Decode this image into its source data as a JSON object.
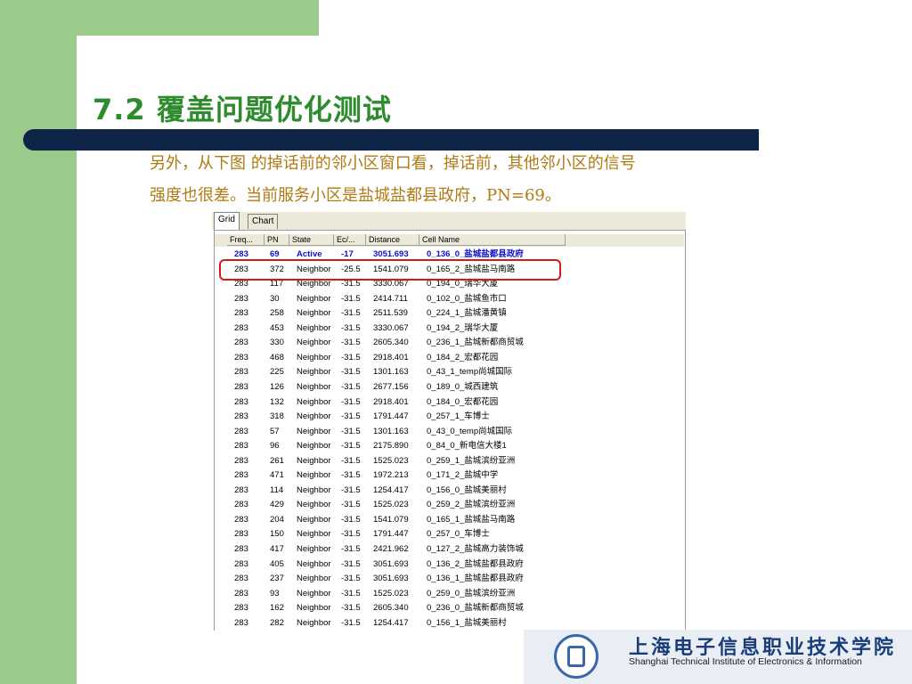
{
  "slide": {
    "title": "7.2  覆盖问题优化测试",
    "body_line1": "另外，从下图 的掉话前的邻小区窗口看，掉话前，其他邻小区的信号",
    "body_line2": "强度也很差。当前服务小区是盐城盐都县政府，PN=69。"
  },
  "app": {
    "tabs": [
      "Grid",
      "Chart"
    ],
    "selected_tab": "Grid",
    "columns": [
      "Freq...",
      "PN",
      "State",
      "Ec/...",
      "Distance",
      "Cell Name"
    ],
    "rows": [
      [
        "283",
        "69",
        "Active",
        "-17",
        "3051.693",
        "0_136_0_盐城盐都县政府"
      ],
      [
        "283",
        "372",
        "Neighbor",
        "-25.5",
        "1541.079",
        "0_165_2_盐城盐马南路"
      ],
      [
        "283",
        "117",
        "Neighbor",
        "-31.5",
        "3330.067",
        "0_194_0_瑞华大厦"
      ],
      [
        "283",
        "30",
        "Neighbor",
        "-31.5",
        "2414.711",
        "0_102_0_盐城鱼市口"
      ],
      [
        "283",
        "258",
        "Neighbor",
        "-31.5",
        "2511.539",
        "0_224_1_盐城潘黄镇"
      ],
      [
        "283",
        "453",
        "Neighbor",
        "-31.5",
        "3330.067",
        "0_194_2_瑞华大厦"
      ],
      [
        "283",
        "330",
        "Neighbor",
        "-31.5",
        "2605.340",
        "0_236_1_盐城新都商贸城"
      ],
      [
        "283",
        "468",
        "Neighbor",
        "-31.5",
        "2918.401",
        "0_184_2_宏都花园"
      ],
      [
        "283",
        "225",
        "Neighbor",
        "-31.5",
        "1301.163",
        "0_43_1_temp尚城国际"
      ],
      [
        "283",
        "126",
        "Neighbor",
        "-31.5",
        "2677.156",
        "0_189_0_城西建筑"
      ],
      [
        "283",
        "132",
        "Neighbor",
        "-31.5",
        "2918.401",
        "0_184_0_宏都花园"
      ],
      [
        "283",
        "318",
        "Neighbor",
        "-31.5",
        "1791.447",
        "0_257_1_车博士"
      ],
      [
        "283",
        "57",
        "Neighbor",
        "-31.5",
        "1301.163",
        "0_43_0_temp尚城国际"
      ],
      [
        "283",
        "96",
        "Neighbor",
        "-31.5",
        "2175.890",
        "0_84_0_新电信大楼1"
      ],
      [
        "283",
        "261",
        "Neighbor",
        "-31.5",
        "1525.023",
        "0_259_1_盐城滨纷亚洲"
      ],
      [
        "283",
        "471",
        "Neighbor",
        "-31.5",
        "1972.213",
        "0_171_2_盐城中学"
      ],
      [
        "283",
        "114",
        "Neighbor",
        "-31.5",
        "1254.417",
        "0_156_0_盐城美丽村"
      ],
      [
        "283",
        "429",
        "Neighbor",
        "-31.5",
        "1525.023",
        "0_259_2_盐城滨纷亚洲"
      ],
      [
        "283",
        "204",
        "Neighbor",
        "-31.5",
        "1541.079",
        "0_165_1_盐城盐马南路"
      ],
      [
        "283",
        "150",
        "Neighbor",
        "-31.5",
        "1791.447",
        "0_257_0_车博士"
      ],
      [
        "283",
        "417",
        "Neighbor",
        "-31.5",
        "2421.962",
        "0_127_2_盐城高力装饰城"
      ],
      [
        "283",
        "405",
        "Neighbor",
        "-31.5",
        "3051.693",
        "0_136_2_盐城盐都县政府"
      ],
      [
        "283",
        "237",
        "Neighbor",
        "-31.5",
        "3051.693",
        "0_136_1_盐城盐都县政府"
      ],
      [
        "283",
        "93",
        "Neighbor",
        "-31.5",
        "1525.023",
        "0_259_0_盐城滨纷亚洲"
      ],
      [
        "283",
        "162",
        "Neighbor",
        "-31.5",
        "2605.340",
        "0_236_0_盐城新都商贸城"
      ],
      [
        "283",
        "282",
        "Neighbor",
        "-31.5",
        "1254.417",
        "0_156_1_盐城美丽村"
      ]
    ]
  },
  "logo": {
    "chinese": "上海电子信息职业技术学院",
    "english": "Shanghai Technical Institute of Electronics & Information"
  },
  "colors": {
    "title": "#2e8b2e",
    "body_text": "#b07a12",
    "navy_bar": "#0f2547",
    "green_band": "#9acb8a",
    "active_row": "#1010c8",
    "highlight": "#d21a1a"
  }
}
